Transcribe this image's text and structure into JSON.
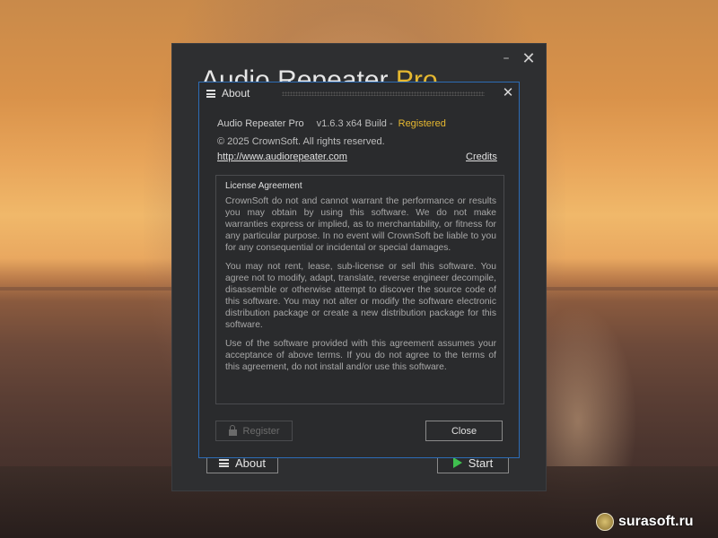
{
  "main_window": {
    "title_main": "Audio Repeater",
    "title_accent": "Pro",
    "minimize_glyph": "–",
    "close_glyph": "✕",
    "about_button_label": "About",
    "start_button_label": "Start",
    "accent_color": "#e6b830"
  },
  "about_dialog": {
    "title": "About",
    "close_glyph": "✕",
    "product_name": "Audio Repeater Pro",
    "version": "v1.6.3 x64 Build -",
    "registration_status": "Registered",
    "copyright": "© 2025 CrownSoft. All rights reserved.",
    "website": "http://www.audiorepeater.com",
    "credits_label": "Credits",
    "license_heading": "License Agreement",
    "license_paragraphs": [
      "CrownSoft do not and cannot warrant the performance or results you may obtain by using this software. We do not make warranties express or implied, as to merchantability, or fitness for any particular purpose. In no event will CrownSoft be liable to you for any consequential or incidental or special damages.",
      "You may not rent, lease, sub-license or sell this software. You agree not to modify, adapt, translate, reverse engineer decompile, disassemble or otherwise attempt to discover the source code of this software. You may not alter or modify the software electronic distribution package or create a new distribution package for this software.",
      "Use of the software provided with this agreement assumes your acceptance of above terms. If you do not agree to the terms of this agreement, do not install and/or use this software."
    ],
    "register_button_label": "Register",
    "close_button_label": "Close",
    "border_color": "#2d6cb5"
  },
  "watermark": {
    "text": "surasoft.ru"
  }
}
